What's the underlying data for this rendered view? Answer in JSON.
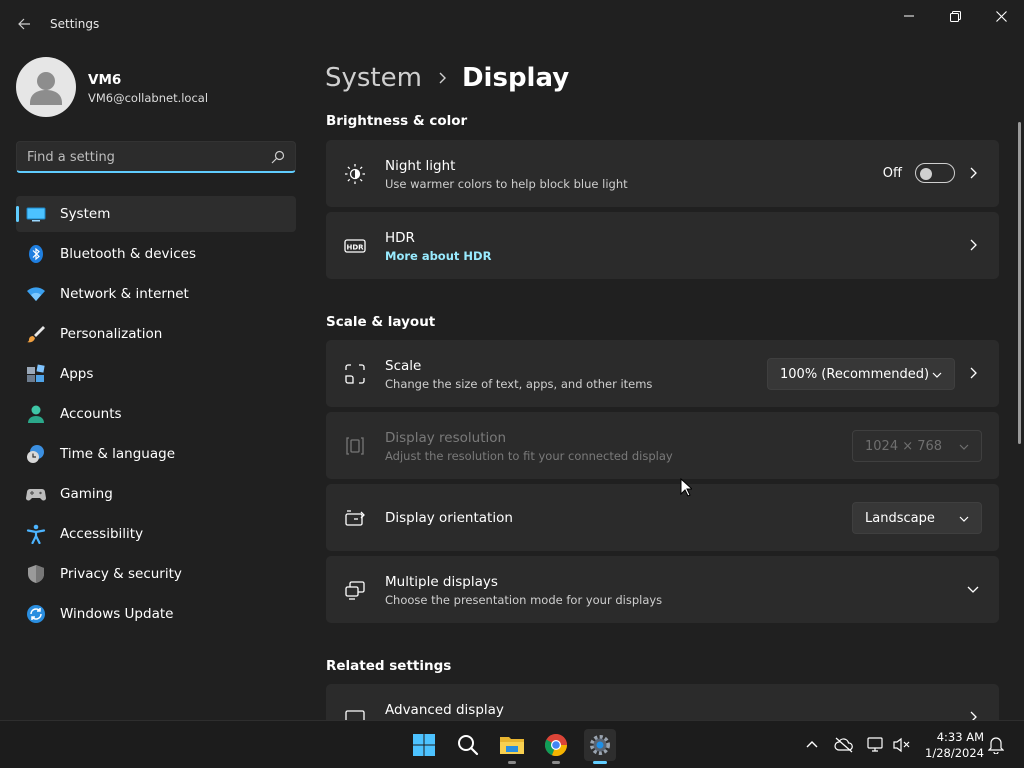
{
  "window": {
    "title": "Settings"
  },
  "profile": {
    "name": "VM6",
    "email": "VM6@collabnet.local"
  },
  "search": {
    "placeholder": "Find a setting"
  },
  "sidebar": {
    "items": [
      {
        "label": "System",
        "icon": "system-icon",
        "selected": true
      },
      {
        "label": "Bluetooth & devices",
        "icon": "bluetooth-icon"
      },
      {
        "label": "Network & internet",
        "icon": "wifi-icon"
      },
      {
        "label": "Personalization",
        "icon": "brush-icon"
      },
      {
        "label": "Apps",
        "icon": "apps-icon"
      },
      {
        "label": "Accounts",
        "icon": "accounts-icon"
      },
      {
        "label": "Time & language",
        "icon": "clock-globe-icon"
      },
      {
        "label": "Gaming",
        "icon": "gamepad-icon"
      },
      {
        "label": "Accessibility",
        "icon": "accessibility-icon"
      },
      {
        "label": "Privacy & security",
        "icon": "shield-icon"
      },
      {
        "label": "Windows Update",
        "icon": "update-icon"
      }
    ]
  },
  "breadcrumb": {
    "parent": "System",
    "current": "Display"
  },
  "sections": {
    "brightness": "Brightness & color",
    "scale": "Scale & layout",
    "related": "Related settings"
  },
  "cards": {
    "night_light": {
      "title": "Night light",
      "subtitle": "Use warmer colors to help block blue light",
      "toggle_state": "Off"
    },
    "hdr": {
      "title": "HDR",
      "link": "More about HDR"
    },
    "scale": {
      "title": "Scale",
      "subtitle": "Change the size of text, apps, and other items",
      "value": "100% (Recommended)"
    },
    "resolution": {
      "title": "Display resolution",
      "subtitle": "Adjust the resolution to fit your connected display",
      "value": "1024 × 768"
    },
    "orientation": {
      "title": "Display orientation",
      "value": "Landscape"
    },
    "multiple": {
      "title": "Multiple displays",
      "subtitle": "Choose the presentation mode for your displays"
    },
    "advanced": {
      "title": "Advanced display"
    }
  },
  "taskbar": {
    "apps": [
      "start-icon",
      "search-icon",
      "file-explorer-icon",
      "chrome-icon",
      "settings-icon"
    ],
    "time": "4:33 AM",
    "date": "1/28/2024"
  },
  "colors": {
    "accent": "#60cdff",
    "background": "#202020",
    "card": "#2b2b2b"
  }
}
